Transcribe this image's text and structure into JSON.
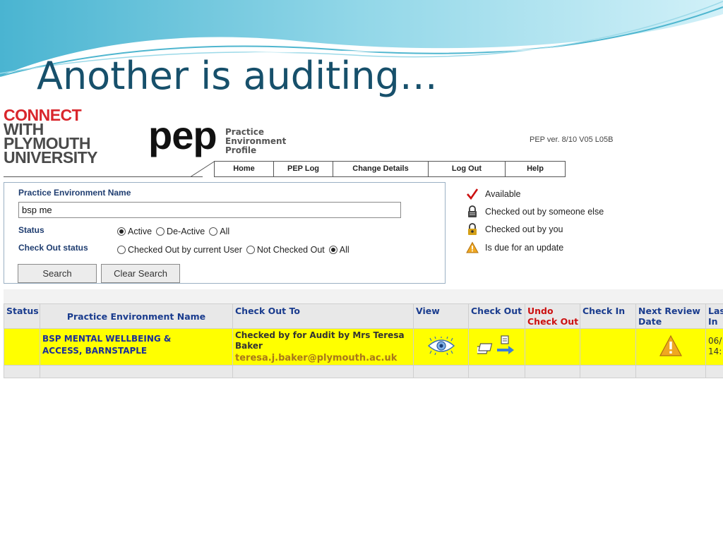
{
  "slide": {
    "title": "Another is auditing…"
  },
  "logo": {
    "line1": "CONNECT",
    "line2": "WITH",
    "line3": "PLYMOUTH",
    "line4": "UNIVERSITY"
  },
  "pep": {
    "mark": "pep",
    "sub1": "Practice",
    "sub2": "Environment",
    "sub3": "Profile",
    "version": "PEP ver. 8/10 V05 L05B"
  },
  "nav": {
    "items": [
      "Home",
      "PEP Log",
      "Change Details",
      "Log Out",
      "Help"
    ]
  },
  "search": {
    "name_label": "Practice Environment Name",
    "name_value": "bsp me",
    "status_label": "Status",
    "status_options": [
      "Active",
      "De-Active",
      "All"
    ],
    "status_selected": "Active",
    "checkout_label": "Check Out status",
    "checkout_options": [
      "Checked Out by current User",
      "Not Checked Out",
      "All"
    ],
    "checkout_selected": "All",
    "search_button": "Search",
    "clear_button": "Clear Search"
  },
  "legend": {
    "available": "Available",
    "checked_other": "Checked out by someone else",
    "checked_you": "Checked out by you",
    "due_update": "Is due for an update"
  },
  "table": {
    "headers": {
      "status": "Status",
      "name": "Practice Environment Name",
      "checkout_to": "Check Out To",
      "view": "View",
      "checkout": "Check Out",
      "undo1": "Undo",
      "undo2": "Check Out",
      "checkin": "Check In",
      "review1": "Next Review",
      "review2": "Date",
      "last1": "Last",
      "last2": "In"
    },
    "row": {
      "name1": "BSP MENTAL WELLBEING &",
      "name2": "ACCESS, BARNSTAPLE",
      "checked_by1": "Checked by for Audit by Mrs Teresa",
      "checked_by2": "Baker",
      "email": "teresa.j.baker@plymouth.ac.uk",
      "last1": "06/",
      "last2": "14:"
    }
  },
  "icons": {
    "available": "checkmark-icon",
    "checked_other": "lock-icon",
    "checked_you": "lock-key-icon",
    "due_update": "warning-icon",
    "view": "eye-icon",
    "checkout": "checkout-files-icon",
    "review": "warning-icon"
  },
  "colors": {
    "title": "#17506b",
    "highlight": "#ffff00",
    "header_text": "#1a3c8e",
    "undo_red": "#cc1111",
    "logo_red": "#d9262c"
  }
}
